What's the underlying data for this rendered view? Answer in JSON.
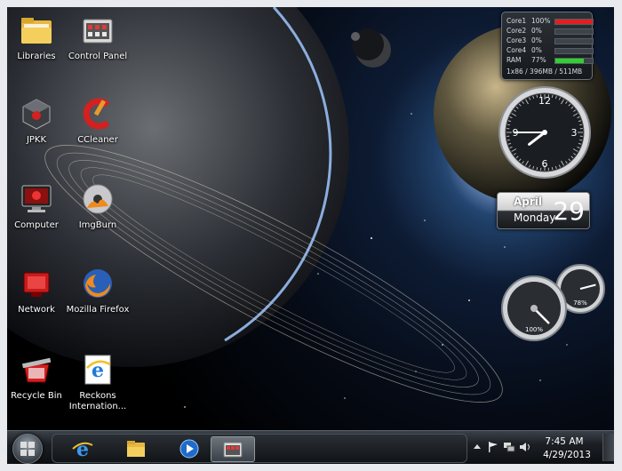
{
  "desktop_icons": [
    {
      "label": "Libraries",
      "icon": "folder-libraries-icon"
    },
    {
      "label": "Control Panel",
      "icon": "control-panel-icon"
    },
    {
      "label": "JPKK",
      "icon": "jpkk-cube-icon"
    },
    {
      "label": "CCleaner",
      "icon": "ccleaner-icon"
    },
    {
      "label": "Computer",
      "icon": "computer-icon"
    },
    {
      "label": "ImgBurn",
      "icon": "imgburn-disc-icon"
    },
    {
      "label": "Network",
      "icon": "network-icon"
    },
    {
      "label": "Mozilla Firefox",
      "icon": "firefox-icon"
    },
    {
      "label": "Recycle Bin",
      "icon": "recycle-bin-icon"
    },
    {
      "label": "Reckons Internation...",
      "icon": "internet-explorer-icon"
    }
  ],
  "cpu_meter": {
    "rows": [
      {
        "name": "Core1",
        "value": "100%",
        "level": 1.0,
        "color": "#e01f1f"
      },
      {
        "name": "Core2",
        "value": "0%",
        "level": 0.0,
        "color": "#3cbf3c"
      },
      {
        "name": "Core3",
        "value": "0%",
        "level": 0.0,
        "color": "#3cbf3c"
      },
      {
        "name": "Core4",
        "value": "0%",
        "level": 0.0,
        "color": "#3cbf3c"
      },
      {
        "name": "RAM",
        "value": "77%",
        "level": 0.77,
        "color": "#2fd12f"
      }
    ],
    "memory": "1x86 / 396MB / 511MB"
  },
  "clock": {
    "numerals": [
      "12",
      "3",
      "6",
      "9"
    ],
    "hour": 7,
    "minute": 45
  },
  "calendar": {
    "month": "April",
    "weekday": "Monday",
    "date": "29"
  },
  "gauges": {
    "cpu_label": "100%",
    "cpu_level": 1.0,
    "mem_label": "78%",
    "mem_level": 0.78
  },
  "taskbar": {
    "pinned": [
      {
        "name": "Internet Explorer",
        "icon": "internet-explorer-icon",
        "active": false
      },
      {
        "name": "Windows Explorer",
        "icon": "folder-icon",
        "active": false
      },
      {
        "name": "Windows Media Player",
        "icon": "media-player-icon",
        "active": false
      },
      {
        "name": "Control Panel",
        "icon": "control-panel-icon",
        "active": true
      }
    ],
    "tray_icons": [
      "arrow-up-icon",
      "action-center-flag-icon",
      "network-icon",
      "volume-icon"
    ],
    "time": "7:45 AM",
    "date": "4/29/2013"
  },
  "colors": {
    "taskbar": "#1b1f24",
    "clock_face": "#1a1d21",
    "accent_red": "#d42020"
  }
}
